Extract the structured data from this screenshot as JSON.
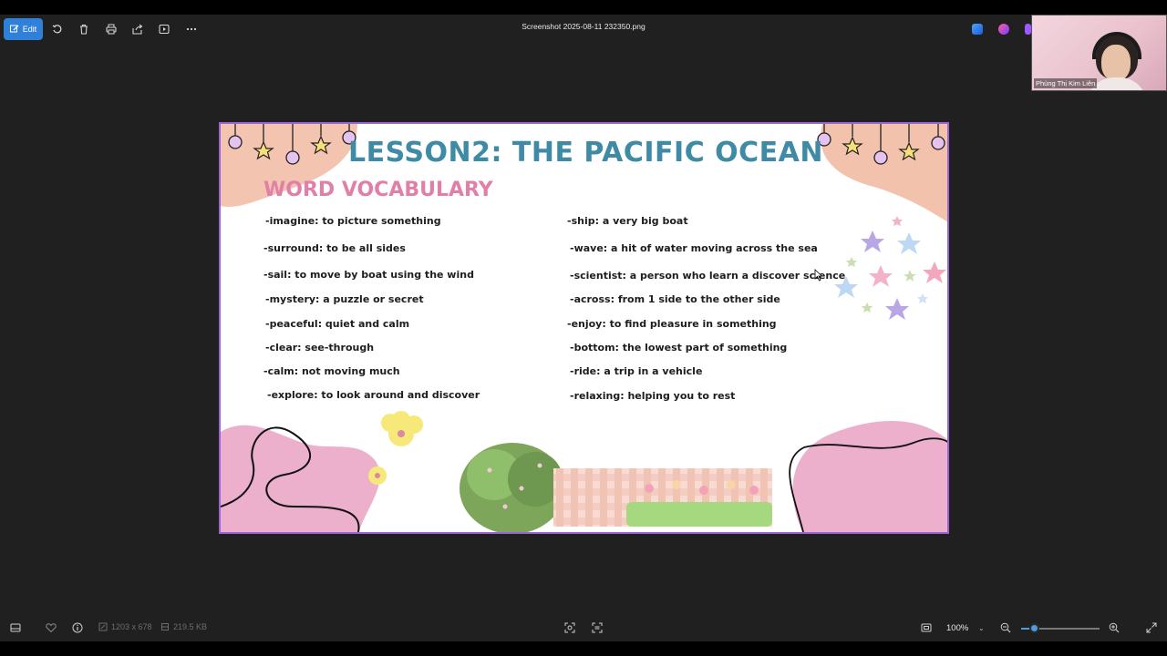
{
  "toolbar": {
    "edit_label": "Edit",
    "file_title": "Screenshot 2025-08-11 232350.png",
    "icons": [
      "rotate-icon",
      "delete-icon",
      "print-icon",
      "share-icon",
      "slideshow-icon",
      "more-icon"
    ]
  },
  "webcam": {
    "participant_name": "Phùng Thị Kim Liên"
  },
  "slide": {
    "title": "LESSON2: THE PACIFIC OCEAN",
    "subtitle": "WORD VOCABULARY",
    "left_column": [
      "-imagine: to picture something",
      "-surround: to be all sides",
      "-sail: to move by boat using the wind",
      "-mystery: a puzzle or secret",
      "-peaceful: quiet and calm",
      "-clear: see-through",
      "-calm: not moving much",
      "-explore: to look around and discover"
    ],
    "right_column": [
      "-ship: a very big boat",
      "-wave: a hit of water moving across the sea",
      "-scientist: a person who learn a discover science",
      "-across: from 1 side to the other side",
      "-enjoy: to find pleasure in something",
      "-bottom: the lowest part of something",
      "-ride: a trip in a vehicle",
      "-relaxing: helping you to rest"
    ]
  },
  "statusbar": {
    "dimensions": "1203 x 678",
    "file_size": "219.5 KB",
    "zoom": "100%",
    "zoom_level_fraction": 0.15
  },
  "colors": {
    "accent": "#2f80d8",
    "title": "#3f8ba6",
    "subtitle": "#e17fa8",
    "slide_border": "#9c63d6"
  }
}
